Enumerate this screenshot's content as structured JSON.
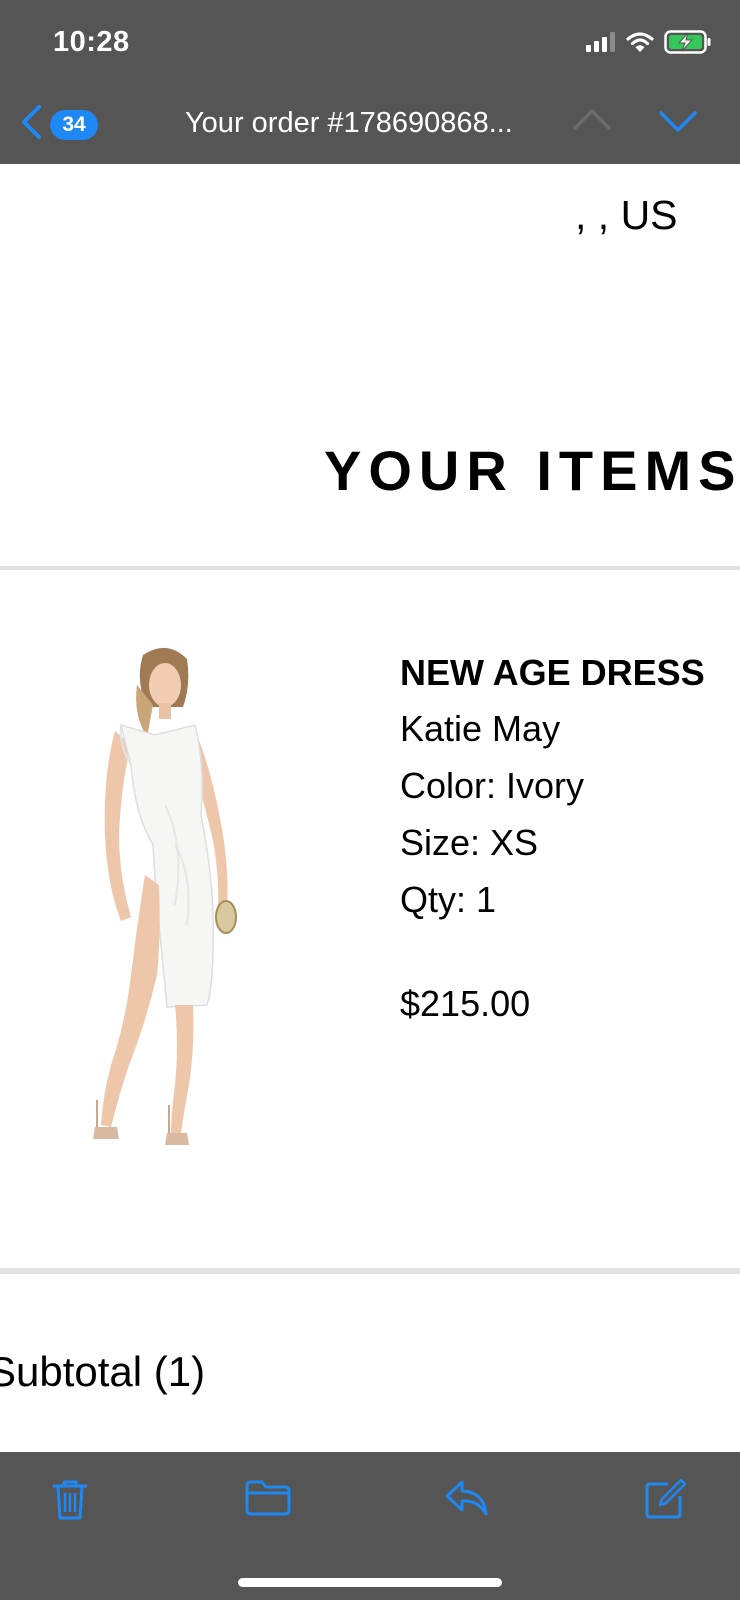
{
  "status_bar": {
    "time": "10:28"
  },
  "nav": {
    "unread_count": "34",
    "title": "Your order #178690868..."
  },
  "shipping_address": {
    "line": ", , US"
  },
  "items_section": {
    "heading": "YOUR ITEMS"
  },
  "product": {
    "name": "NEW AGE DRESS",
    "brand": "Katie May",
    "color": "Color: Ivory",
    "size": "Size: XS",
    "qty": "Qty: 1",
    "price": "$215.00"
  },
  "summary": {
    "subtotal_label": "Subtotal (1)"
  },
  "colors": {
    "accent": "#1e88f5",
    "chrome": "#555555",
    "battery": "#34c759"
  },
  "toolbar": {
    "icons": [
      "trash-icon",
      "folder-icon",
      "reply-icon",
      "compose-icon"
    ]
  }
}
